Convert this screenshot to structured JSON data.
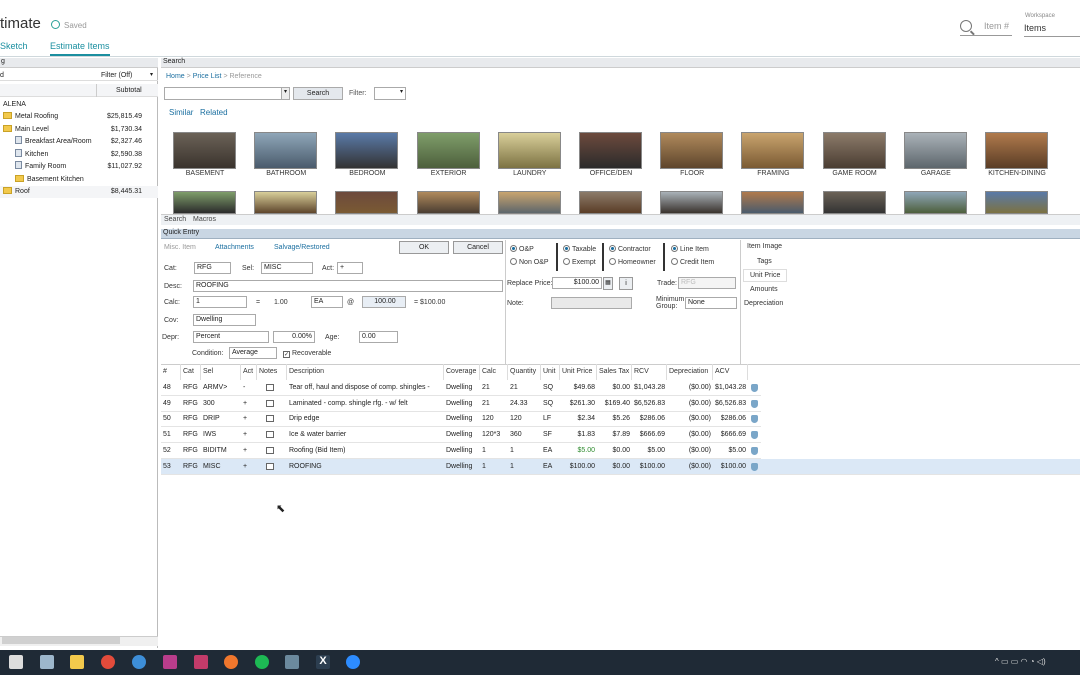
{
  "header": {
    "app_title": "timate",
    "saved_label": "Saved",
    "tab_sketch": "Sketch",
    "tab_estimate_items": "Estimate Items",
    "item_input_placeholder": "Item #",
    "workspace_label": "Workspace",
    "workspace_value": "Items"
  },
  "left_panel": {
    "head_label": "g",
    "filter_label": "Filter (Off)",
    "col_left": "d",
    "col_subtotal": "Subtotal",
    "project": "ALENA",
    "rows": [
      {
        "label": "Metal Roofing",
        "subtotal": "$25,815.49",
        "icon": "folder-icon"
      },
      {
        "label": "Main Level",
        "subtotal": "$1,730.34",
        "icon": "folder-icon"
      },
      {
        "label": "Breakfast Area/Room",
        "subtotal": "$2,327.46",
        "icon": "room-icon"
      },
      {
        "label": "Kitchen",
        "subtotal": "$2,590.38",
        "icon": "room-icon"
      },
      {
        "label": "Family Room",
        "subtotal": "$11,027.92",
        "icon": "room-icon"
      },
      {
        "label": "Basement Kitchen",
        "subtotal": "",
        "icon": "folder-icon"
      },
      {
        "label": "Roof",
        "subtotal": "$8,445.31",
        "icon": "folder-icon"
      }
    ]
  },
  "search_panel": {
    "head": "Search",
    "crumb_home": "Home",
    "crumb_sep": ">",
    "crumb_pricelist": "Price List",
    "crumb_reference": "Reference",
    "search_button": "Search",
    "filter_label": "Filter:",
    "similar": "Similar",
    "related": "Related",
    "categories": [
      "BASEMENT",
      "BATHROOM",
      "BEDROOM",
      "EXTERIOR",
      "LAUNDRY",
      "OFFICE/DEN",
      "FLOOR",
      "FRAMING",
      "GAME ROOM",
      "GARAGE",
      "KITCHEN-DINING"
    ],
    "tab_search": "Search",
    "tab_macros": "Macros"
  },
  "quick_entry": {
    "head": "Quick Entry",
    "tab_misc": "Misc. Item",
    "tab_attachments": "Attachments",
    "tab_salvage": "Salvage/Restored",
    "ok": "OK",
    "cancel": "Cancel",
    "cat_label": "Cat:",
    "cat_value": "RFG",
    "sel_label": "Sel:",
    "sel_value": "MISC",
    "act_label": "Act:",
    "act_value": "+",
    "desc_label": "Desc:",
    "desc_value": "ROOFING",
    "calc_label": "Calc:",
    "calc_value": "1",
    "eq": "=",
    "qty": "1.00",
    "unit": "EA",
    "at": "@",
    "price": "100.00",
    "total": "= $100.00",
    "cov_label": "Cov:",
    "cov_value": "Dwelling",
    "depr_label": "Depr:",
    "depr_value": "Percent",
    "depr_pct": "0.00%",
    "age_label": "Age:",
    "age_value": "0.00",
    "condition_label": "Condition:",
    "condition_value": "Average",
    "recoverable": "Recoverable",
    "op": "O&P",
    "non_op": "Non O&P",
    "taxable": "Taxable",
    "exempt": "Exempt",
    "contractor": "Contractor",
    "homeowner": "Homeowner",
    "line_item": "Line Item",
    "credit_item": "Credit Item",
    "replace_price_label": "Replace Price:",
    "replace_price_value": "$100.00",
    "trade_label": "Trade:",
    "trade_value": "RFG",
    "note_label": "Note:",
    "min_group_label1": "Minimum",
    "min_group_label2": "Group:",
    "min_group_value": "None",
    "side_links": [
      "Item Image",
      "Tags",
      "Unit Price",
      "Amounts",
      "Depreciation"
    ]
  },
  "table": {
    "headers": [
      "#",
      "Cat",
      "Sel",
      "Act",
      "Notes",
      "Description",
      "Coverage",
      "Calc",
      "Quantity",
      "Unit",
      "Unit Price",
      "Sales Tax",
      "RCV",
      "Depreciation",
      "ACV"
    ],
    "rows": [
      {
        "num": "48",
        "cat": "RFG",
        "sel": "ARMV>",
        "act": "-",
        "desc": "Tear off, haul and dispose of comp. shingles -",
        "cov": "Dwelling",
        "calc": "21",
        "qty": "21",
        "unit": "SQ",
        "price": "$49.68",
        "tax": "$0.00",
        "rcv": "$1,043.28",
        "dep": "($0.00)",
        "acv": "$1,043.28"
      },
      {
        "num": "49",
        "cat": "RFG",
        "sel": "300",
        "act": "+",
        "desc": "Laminated - comp. shingle rfg. - w/ felt",
        "cov": "Dwelling",
        "calc": "21",
        "qty": "24.33",
        "unit": "SQ",
        "price": "$261.30",
        "tax": "$169.40",
        "rcv": "$6,526.83",
        "dep": "($0.00)",
        "acv": "$6,526.83"
      },
      {
        "num": "50",
        "cat": "RFG",
        "sel": "DRIP",
        "act": "+",
        "desc": "Drip edge",
        "cov": "Dwelling",
        "calc": "120",
        "qty": "120",
        "unit": "LF",
        "price": "$2.34",
        "tax": "$5.26",
        "rcv": "$286.06",
        "dep": "($0.00)",
        "acv": "$286.06"
      },
      {
        "num": "51",
        "cat": "RFG",
        "sel": "IWS",
        "act": "+",
        "desc": "Ice & water barrier",
        "cov": "Dwelling",
        "calc": "120*3",
        "qty": "360",
        "unit": "SF",
        "price": "$1.83",
        "tax": "$7.89",
        "rcv": "$666.69",
        "dep": "($0.00)",
        "acv": "$666.69"
      },
      {
        "num": "52",
        "cat": "RFG",
        "sel": "BIDITM",
        "act": "+",
        "desc": "Roofing (Bid Item)",
        "cov": "Dwelling",
        "calc": "1",
        "qty": "1",
        "unit": "EA",
        "price": "$5.00",
        "tax": "$0.00",
        "rcv": "$5.00",
        "dep": "($0.00)",
        "acv": "$5.00"
      },
      {
        "num": "53",
        "cat": "RFG",
        "sel": "MISC",
        "act": "+",
        "desc": "ROOFING",
        "cov": "Dwelling",
        "calc": "1",
        "qty": "1",
        "unit": "EA",
        "price": "$100.00",
        "tax": "$0.00",
        "rcv": "$100.00",
        "dep": "($0.00)",
        "acv": "$100.00"
      }
    ]
  },
  "colors": {
    "accent": "#1b8fa0",
    "link": "#1b6fa0",
    "green_price": "#2e8b2e",
    "taskbar": "#1f2a36"
  }
}
